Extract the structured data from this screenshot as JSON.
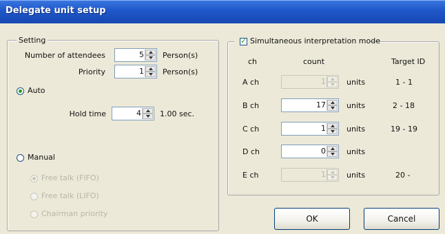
{
  "window": {
    "title": "Delegate unit setup"
  },
  "setting": {
    "legend": "Setting",
    "attendees_label": "Number of attendees",
    "attendees_value": "5",
    "attendees_unit": "Person(s)",
    "priority_label": "Priority",
    "priority_value": "1",
    "priority_unit": "Person(s)",
    "auto_label": "Auto",
    "hold_time_label": "Hold time",
    "hold_time_value": "4",
    "hold_time_unit": "1.00 sec.",
    "manual_label": "Manual",
    "manual_options": [
      "Free talk (FIFO)",
      "Free talk (LIFO)",
      "Chairman priority"
    ],
    "selected_mode": "Auto"
  },
  "interpretation": {
    "checkbox_label": "Simultaneous interpretation mode",
    "checked": true,
    "headers": {
      "ch": "ch",
      "count": "count",
      "target": "Target ID"
    },
    "rows": [
      {
        "ch": "A ch",
        "count": "1",
        "units": "units",
        "target": "1 - 1",
        "enabled": false
      },
      {
        "ch": "B ch",
        "count": "17",
        "units": "units",
        "target": "2 - 18",
        "enabled": true
      },
      {
        "ch": "C ch",
        "count": "1",
        "units": "units",
        "target": "19 - 19",
        "enabled": true
      },
      {
        "ch": "D ch",
        "count": "0",
        "units": "units",
        "target": "",
        "enabled": true
      },
      {
        "ch": "E ch",
        "count": "1",
        "units": "units",
        "target": "20 -",
        "enabled": false
      }
    ]
  },
  "buttons": {
    "ok": "OK",
    "cancel": "Cancel"
  }
}
